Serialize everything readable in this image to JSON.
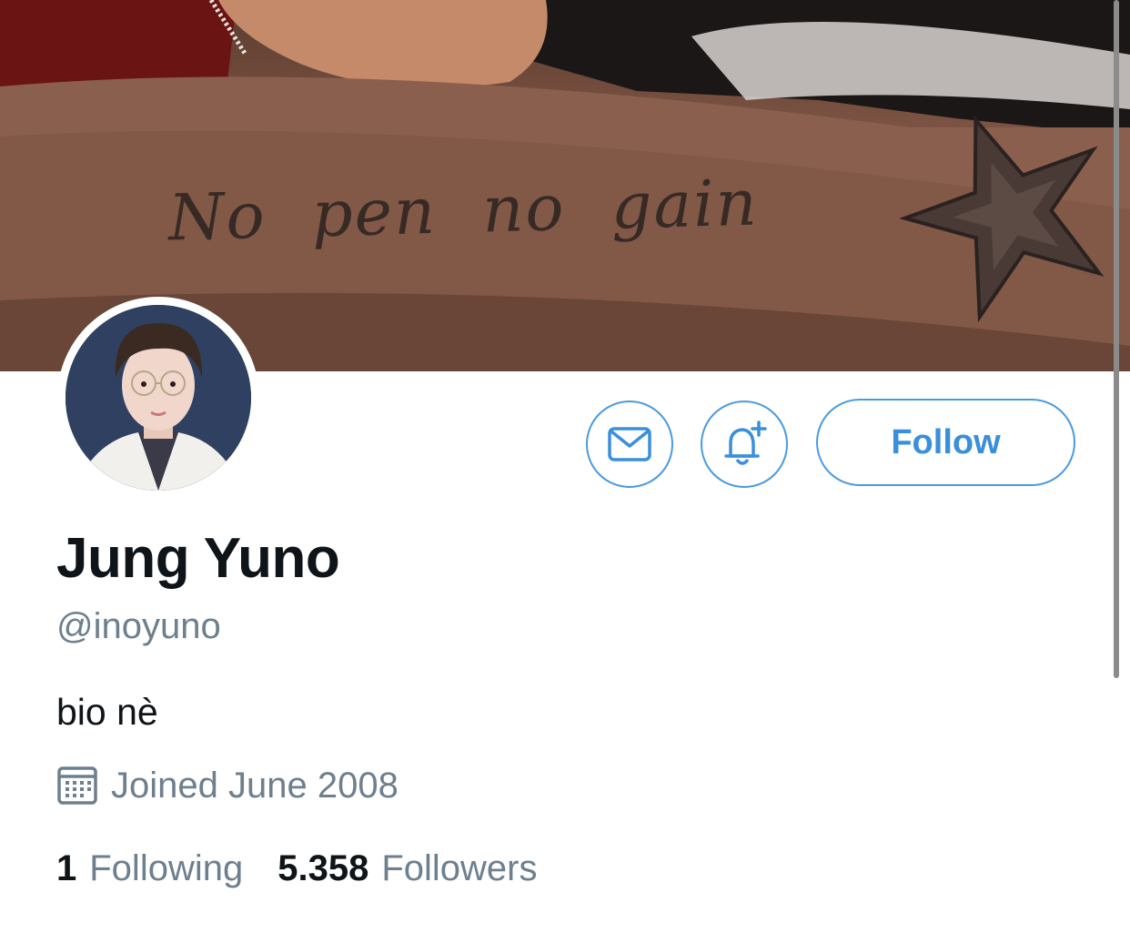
{
  "banner": {
    "tattoo_text": "No pen no gain",
    "icon": "star-tattoo"
  },
  "profile": {
    "name": "Jung Yuno",
    "handle": "@inoyuno",
    "bio": "bio nè",
    "joined": "Joined June 2008",
    "following_count": "1",
    "following_label": "Following",
    "followers_count": "5.358",
    "followers_label": "Followers"
  },
  "actions": {
    "follow_label": "Follow",
    "message_icon": "envelope-icon",
    "notify_icon": "bell-plus-icon"
  },
  "colors": {
    "accent": "#4a9ae0",
    "text_primary": "#0f1419",
    "text_secondary": "#6e7f8d"
  }
}
